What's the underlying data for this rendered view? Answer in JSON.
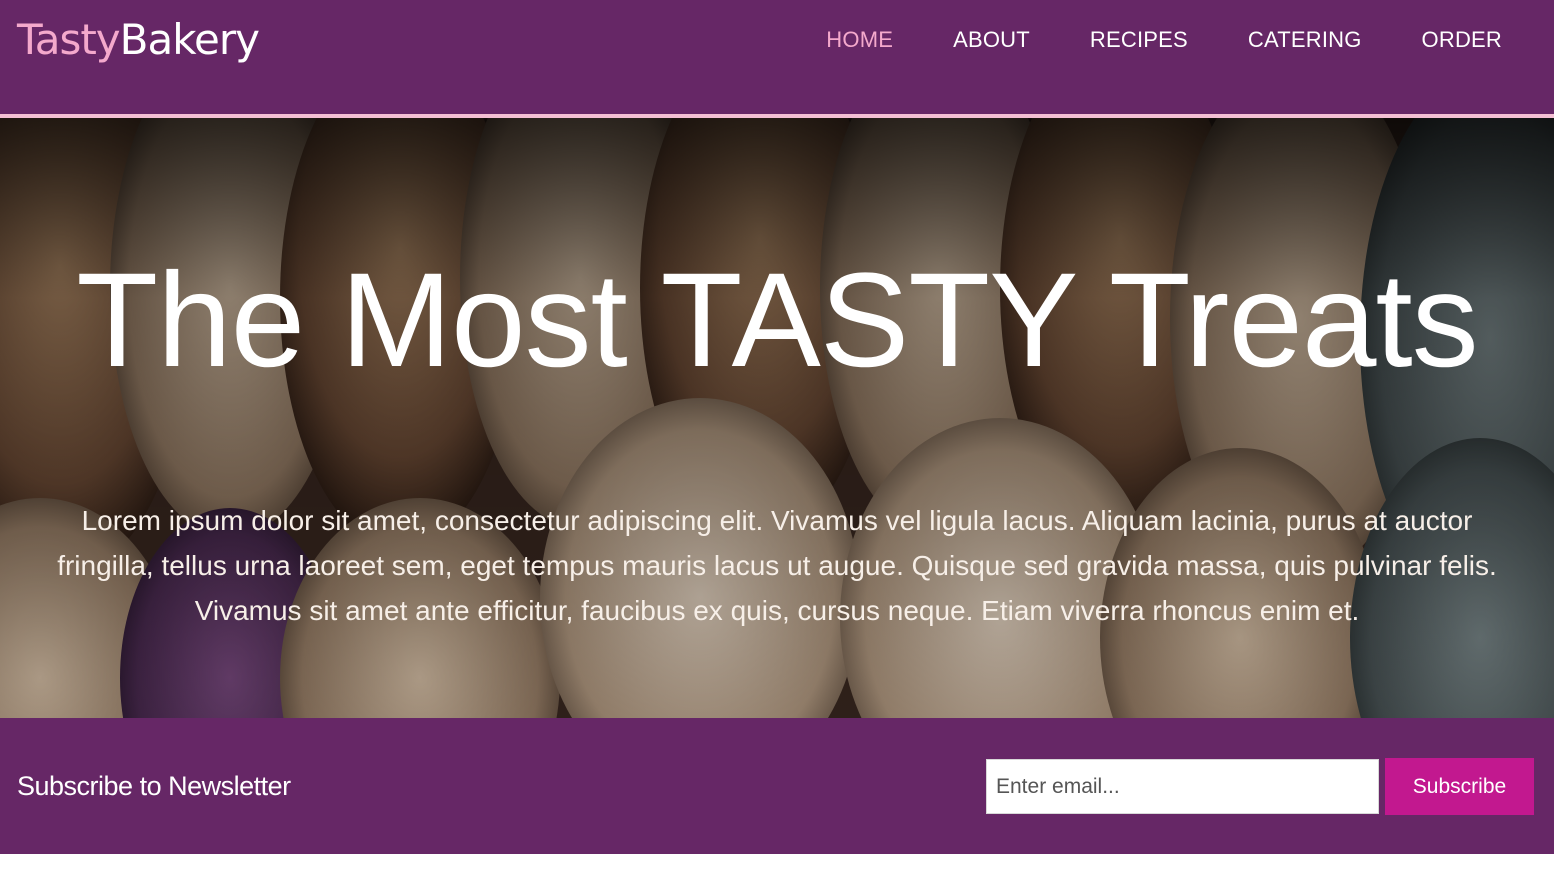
{
  "brand": {
    "logo_part1": "Tasty",
    "logo_part2": "Bakery",
    "primary_color": "#662766",
    "accent_color": "#f4a9cc",
    "button_color": "#c2188f"
  },
  "nav": {
    "items": [
      {
        "label": "HOME",
        "active": true
      },
      {
        "label": "ABOUT",
        "active": false
      },
      {
        "label": "RECIPES",
        "active": false
      },
      {
        "label": "CATERING",
        "active": false
      },
      {
        "label": "ORDER",
        "active": false
      }
    ]
  },
  "hero": {
    "title": "The Most TASTY Treats",
    "body": "Lorem ipsum dolor sit amet, consectetur adipiscing elit. Vivamus vel ligula lacus. Aliquam lacinia, purus at auctor fringilla, tellus urna laoreet sem, eget tempus mauris lacus ut augue. Quisque sed gravida massa, quis pulvinar felis. Vivamus sit amet ante efficitur, faucibus ex quis, cursus neque. Etiam viverra rhoncus enim et."
  },
  "newsletter": {
    "label": "Subscribe to Newsletter",
    "email_placeholder": "Enter email...",
    "email_value": "",
    "button_label": "Subscribe"
  }
}
